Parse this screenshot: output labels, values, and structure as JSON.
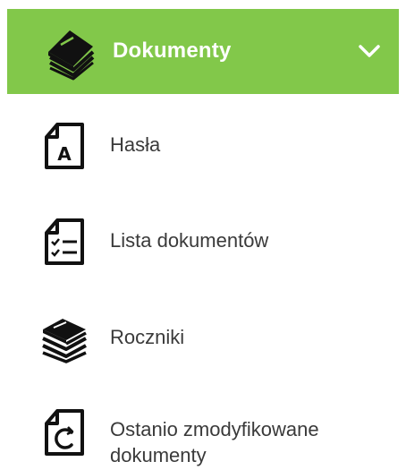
{
  "header": {
    "label": "Dokumenty",
    "icon": "book-stack-icon",
    "expanded_indicator": "chevron-down-icon",
    "background_color": "#82c84a",
    "text_color": "#ffffff"
  },
  "items": [
    {
      "label": "Hasła",
      "icon": "document-a-icon"
    },
    {
      "label": "Lista dokumentów",
      "icon": "document-checklist-icon"
    },
    {
      "label": "Roczniki",
      "icon": "books-stack-icon"
    },
    {
      "label": "Ostanio zmodyfikowane",
      "label_line2": "dokumenty",
      "icon": "document-refresh-icon"
    }
  ]
}
